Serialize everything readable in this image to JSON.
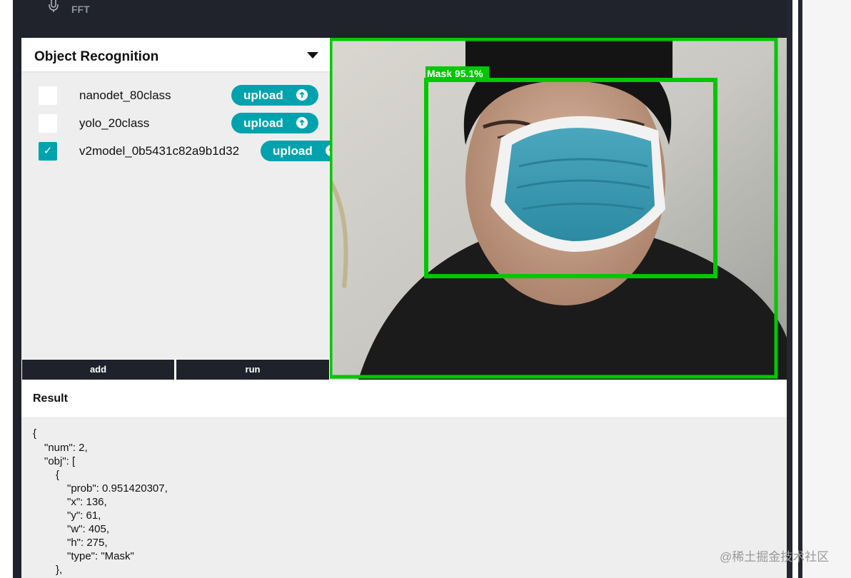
{
  "top_bar": {
    "fft_label": "FFT"
  },
  "panel": {
    "title": "Object Recognition",
    "models": [
      {
        "name": "nanodet_80class",
        "checked": false,
        "upload_label": "upload"
      },
      {
        "name": "yolo_20class",
        "checked": false,
        "upload_label": "upload"
      },
      {
        "name": "v2model_0b5431c82a9b1d32",
        "checked": true,
        "upload_label": "upload"
      }
    ],
    "add_label": "add",
    "run_label": "run",
    "check_mark": "✓"
  },
  "camera": {
    "detection_label": "Mask 95.1%",
    "box_color": "#00c800"
  },
  "result": {
    "title": "Result",
    "json_lines": [
      "{",
      "\"num\": 2,",
      "\"obj\": [",
      "{",
      "\"prob\": 0.951420307,",
      "\"x\": 136,",
      "\"y\": 61,",
      "\"w\": 405,",
      "\"h\": 275,",
      "\"type\": \"Mask\"",
      "},"
    ]
  },
  "watermark": "@稀土掘金技术社区",
  "colors": {
    "accent": "#00a3ad",
    "dark": "#1f222b",
    "panel_bg": "#eeeeee"
  }
}
